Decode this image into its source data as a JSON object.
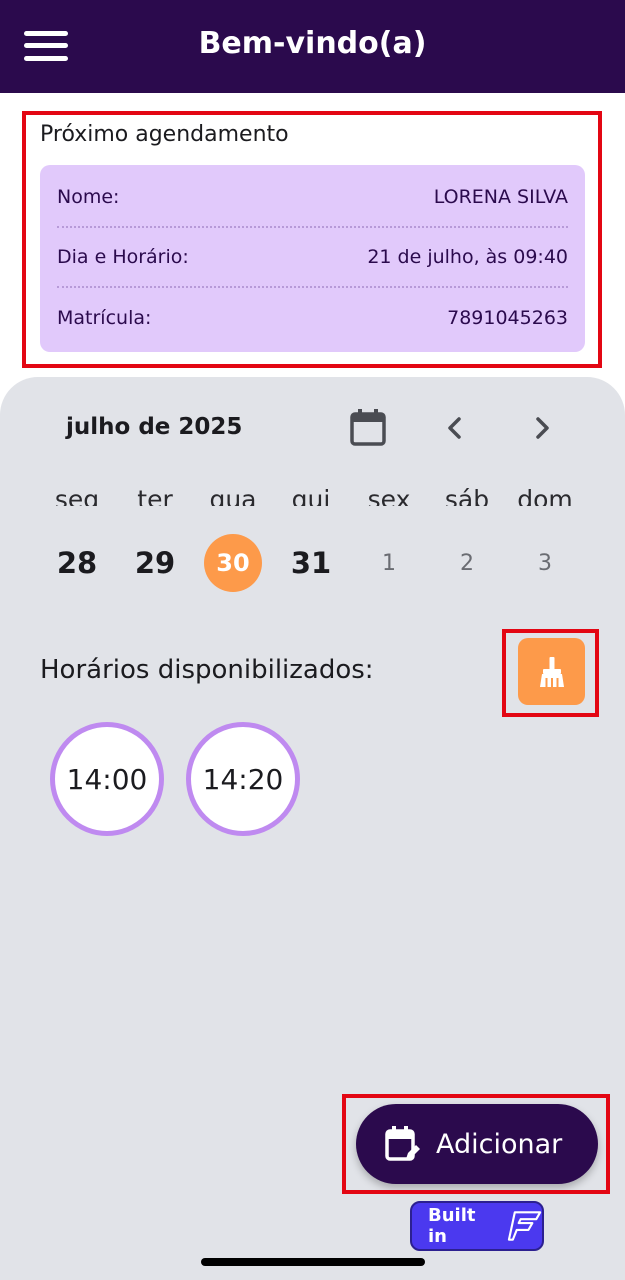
{
  "appbar": {
    "title": "Bem-vindo(a)",
    "menu_icon": "hamburger-menu-icon"
  },
  "next_appointment": {
    "title": "Próximo agendamento",
    "rows": [
      {
        "label": "Nome:",
        "value": "LORENA SILVA"
      },
      {
        "label": "Dia e Horário:",
        "value": "21 de julho, às 09:40"
      },
      {
        "label": "Matrícula:",
        "value": "7891045263"
      }
    ]
  },
  "calendar": {
    "month": "julho de 2025",
    "icons": {
      "calendar": "calendar-icon",
      "prev": "chevron-left-icon",
      "next": "chevron-right-icon"
    },
    "weekdays": [
      "seg",
      "ter",
      "qua",
      "qui",
      "sex",
      "sáb",
      "dom"
    ],
    "days": [
      {
        "label": "28",
        "state": "normal"
      },
      {
        "label": "29",
        "state": "normal"
      },
      {
        "label": "30",
        "state": "selected"
      },
      {
        "label": "31",
        "state": "normal"
      },
      {
        "label": "1",
        "state": "muted"
      },
      {
        "label": "2",
        "state": "muted"
      },
      {
        "label": "3",
        "state": "muted"
      }
    ]
  },
  "slots": {
    "title": "Horários disponibilizados:",
    "clear_icon": "broom-icon",
    "times": [
      "14:00",
      "14:20"
    ]
  },
  "fab": {
    "label": "Adicionar",
    "icon": "calendar-edit-icon"
  },
  "badge": {
    "label": "Built in",
    "icon": "flutterflow-logo-icon"
  },
  "colors": {
    "primary": "#2b0a4d",
    "accent": "#fd9a4a",
    "card": "#e1c9fb",
    "slot_border": "#bf8af0",
    "panel": "#e1e3e8",
    "highlight": "#e30613"
  }
}
